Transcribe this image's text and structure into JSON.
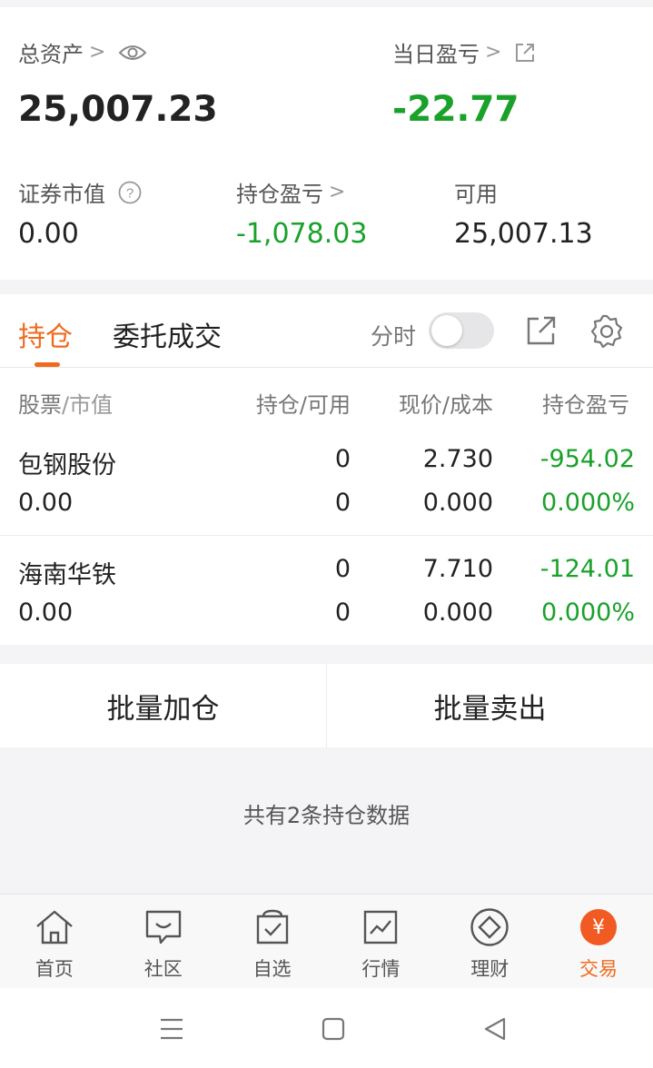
{
  "summary": {
    "total_assets_label": "总资产",
    "total_assets_value": "25,007.23",
    "daily_pnl_label": "当日盈亏",
    "daily_pnl_value": "-22.77",
    "securities_value_label": "证券市值",
    "securities_value": "0.00",
    "position_pnl_label": "持仓盈亏",
    "position_pnl_value": "-1,078.03",
    "available_label": "可用",
    "available_value": "25,007.13",
    "chevron": ">"
  },
  "tabs": {
    "holdings": "持仓",
    "orders": "委托成交",
    "intraday_label": "分时"
  },
  "table": {
    "col1_a": "股票",
    "col1_b": "/市值",
    "col2": "持仓/可用",
    "col3": "现价/成本",
    "col4": "持仓盈亏",
    "rows": [
      {
        "name": "包钢股份",
        "market_value": "0.00",
        "position": "0",
        "available": "0",
        "price": "2.730",
        "cost": "0.000",
        "pnl": "-954.02",
        "pnl_pct": "0.000%"
      },
      {
        "name": "海南华铁",
        "market_value": "0.00",
        "position": "0",
        "available": "0",
        "price": "7.710",
        "cost": "0.000",
        "pnl": "-124.01",
        "pnl_pct": "0.000%"
      }
    ]
  },
  "actions": {
    "batch_add": "批量加仓",
    "batch_sell": "批量卖出"
  },
  "holdings_count_text": "共有2条持仓数据",
  "bottom_nav": [
    {
      "label": "首页",
      "icon": "home-icon"
    },
    {
      "label": "社区",
      "icon": "chat-icon"
    },
    {
      "label": "自选",
      "icon": "watchlist-icon"
    },
    {
      "label": "行情",
      "icon": "chart-icon"
    },
    {
      "label": "理财",
      "icon": "diamond-icon"
    },
    {
      "label": "交易",
      "icon": "yen-icon"
    }
  ],
  "trade_icon_glyph": "¥",
  "colors": {
    "accent": "#f06a1e",
    "loss_green": "#1aa12a"
  }
}
